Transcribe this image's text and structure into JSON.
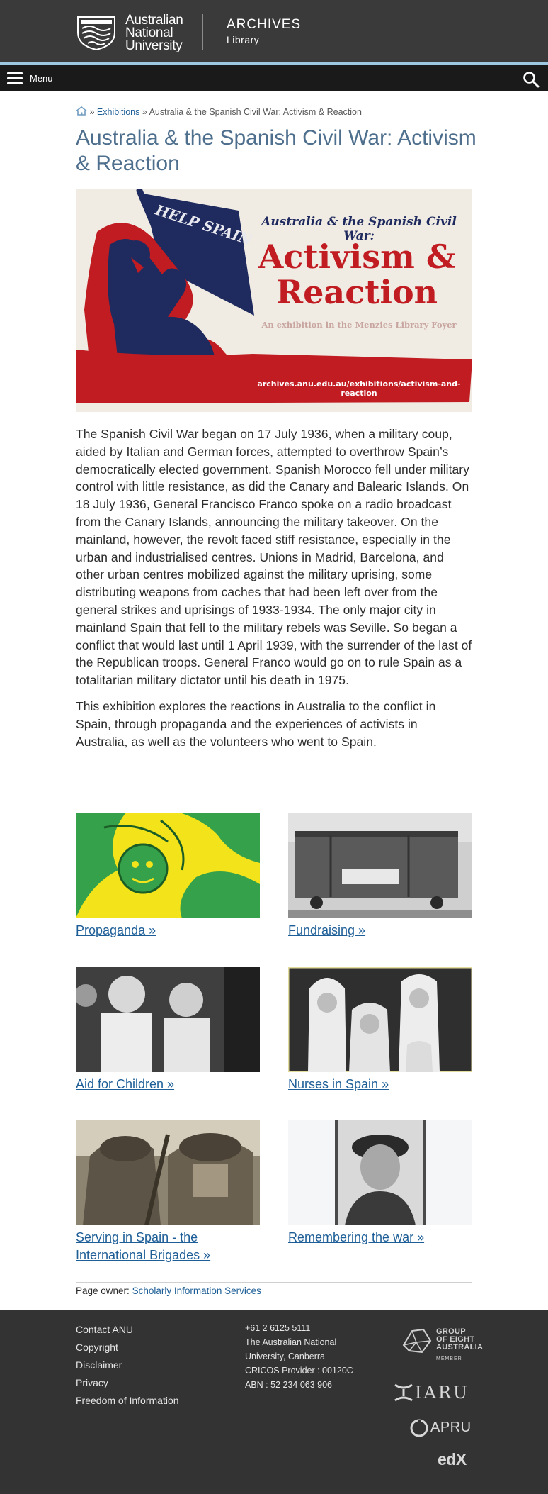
{
  "header": {
    "logo_line1": "Australian",
    "logo_line2": "National",
    "logo_line3": "University",
    "site_title": "ARCHIVES",
    "site_subtitle": "Library"
  },
  "nav": {
    "menu_label": "Menu"
  },
  "breadcrumb": {
    "sep1": " » ",
    "exhibitions": "Exhibitions",
    "sep2": " » ",
    "current": "Australia & the Spanish Civil War: Activism & Reaction"
  },
  "page_title": "Australia & the Spanish Civil War: Activism & Reaction",
  "banner": {
    "flag_text": "HELP SPAIN",
    "subtitle": "Australia & the Spanish Civil War:",
    "title_line1": "Activism &",
    "title_line2": "Reaction",
    "note": "An exhibition in the Menzies Library Foyer",
    "url": "archives.anu.edu.au/exhibitions/activism-and-reaction"
  },
  "intro": {
    "paragraph1": "The Spanish Civil War began on 17 July 1936, when a military coup, aided by Italian and German forces, attempted to overthrow Spain’s democratically elected government. Spanish Morocco fell under military control with little resistance, as did the Canary and Balearic Islands. On 18 July 1936, General Francisco Franco spoke on a radio broadcast from the Canary Islands, announcing the military takeover. On the mainland, however, the revolt faced stiff resistance, especially in the urban and industrialised centres. Unions in Madrid, Barcelona, and other urban centres mobilized against the military uprising, some distributing weapons from caches that had been left over from the general strikes and uprisings of 1933-1934. The only major city in mainland Spain that fell to the military rebels was Seville. So began a conflict that would last until 1 April 1939, with the surrender of the last of the Republican troops. General Franco would go on to rule Spain as a totalitarian military dictator until his death in 1975.",
    "paragraph2": "This exhibition explores the reactions in Australia to the conflict in Spain, through propaganda and the experiences of activists in Australia, as well as the volunteers who went to Spain."
  },
  "cards": [
    {
      "label": "Propaganda »",
      "icon": "propaganda-poster-image"
    },
    {
      "label": "Fundraising »",
      "icon": "train-wagon-image"
    },
    {
      "label": "Aid for Children »",
      "icon": "children-photo-image"
    },
    {
      "label": "Nurses in Spain »",
      "icon": "nurses-photo-image"
    },
    {
      "label": "Serving in Spain - the International Brigades »",
      "icon": "soldiers-photo-image"
    },
    {
      "label": "Remembering the war »",
      "icon": "portrait-photo-image"
    }
  ],
  "page_owner": {
    "label": "Page owner: ",
    "link": "Scholarly Information Services"
  },
  "footer": {
    "links": [
      "Contact ANU",
      "Copyright",
      "Disclaimer",
      "Privacy",
      "Freedom of Information"
    ],
    "phone": "+61 2 6125 5111",
    "address1": "The Australian National",
    "address2": "University, Canberra",
    "cricos": "CRICOS Provider : 00120C",
    "abn": "ABN : 52 234 063 906",
    "go8_line1": "GROUP",
    "go8_line2": "OF EIGHT",
    "go8_line3": "AUSTRALIA",
    "go8_member": "MEMBER",
    "iaru": "IARU",
    "apru": "APRU",
    "edx": "edX"
  },
  "colors": {
    "header_bg": "#3a3a3a",
    "accent_strip": "#9ec7e1",
    "menu_bg": "#1a1a1a",
    "title": "#4e6f8d",
    "link": "#1d5e97",
    "footer_bg": "#333333",
    "banner_red": "#c01c22",
    "banner_navy": "#1f2a5e"
  }
}
